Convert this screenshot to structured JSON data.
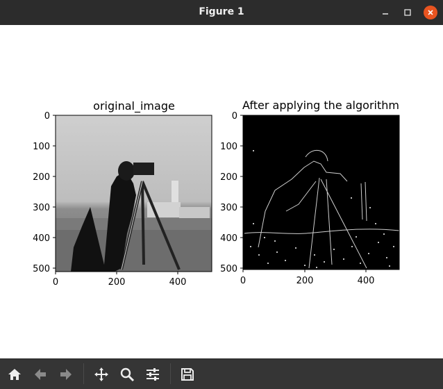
{
  "window": {
    "title": "Figure 1"
  },
  "colors": {
    "titlebar": "#2c2c2c",
    "toolbar": "#353535",
    "close_button": "#e95420"
  },
  "plots": [
    {
      "title": "original_image",
      "x_ticks": [
        "0",
        "200",
        "400"
      ],
      "y_ticks": [
        "0",
        "100",
        "200",
        "300",
        "400",
        "500"
      ]
    },
    {
      "title": "After applying the algorithm",
      "x_ticks": [
        "0",
        "200",
        "400"
      ],
      "y_ticks": [
        "0",
        "100",
        "200",
        "300",
        "400",
        "500"
      ]
    }
  ],
  "toolbar": {
    "icons": [
      "home-icon",
      "back-arrow-icon",
      "forward-arrow-icon",
      "pan-icon",
      "zoom-icon",
      "configure-subplots-icon",
      "save-icon"
    ]
  }
}
